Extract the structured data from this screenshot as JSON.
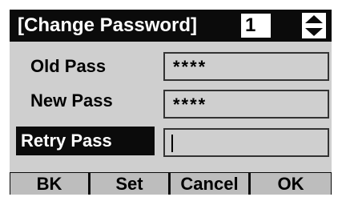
{
  "header": {
    "title": "[Change Password]",
    "page_number": "1"
  },
  "fields": [
    {
      "label": "Old Pass",
      "value": "****",
      "selected": false
    },
    {
      "label": "New Pass",
      "value": "****",
      "selected": false
    },
    {
      "label": "Retry Pass",
      "value": "",
      "selected": true
    }
  ],
  "softkeys": {
    "bk": "BK",
    "set": "Set",
    "cancel": "Cancel",
    "ok": "OK"
  },
  "icons": {
    "scroll": "up-down-arrows-icon"
  },
  "colors": {
    "screen_background": "#cfcfcf",
    "highlight": "#0b0b0b",
    "softkey_background": "#bdbdbd"
  }
}
